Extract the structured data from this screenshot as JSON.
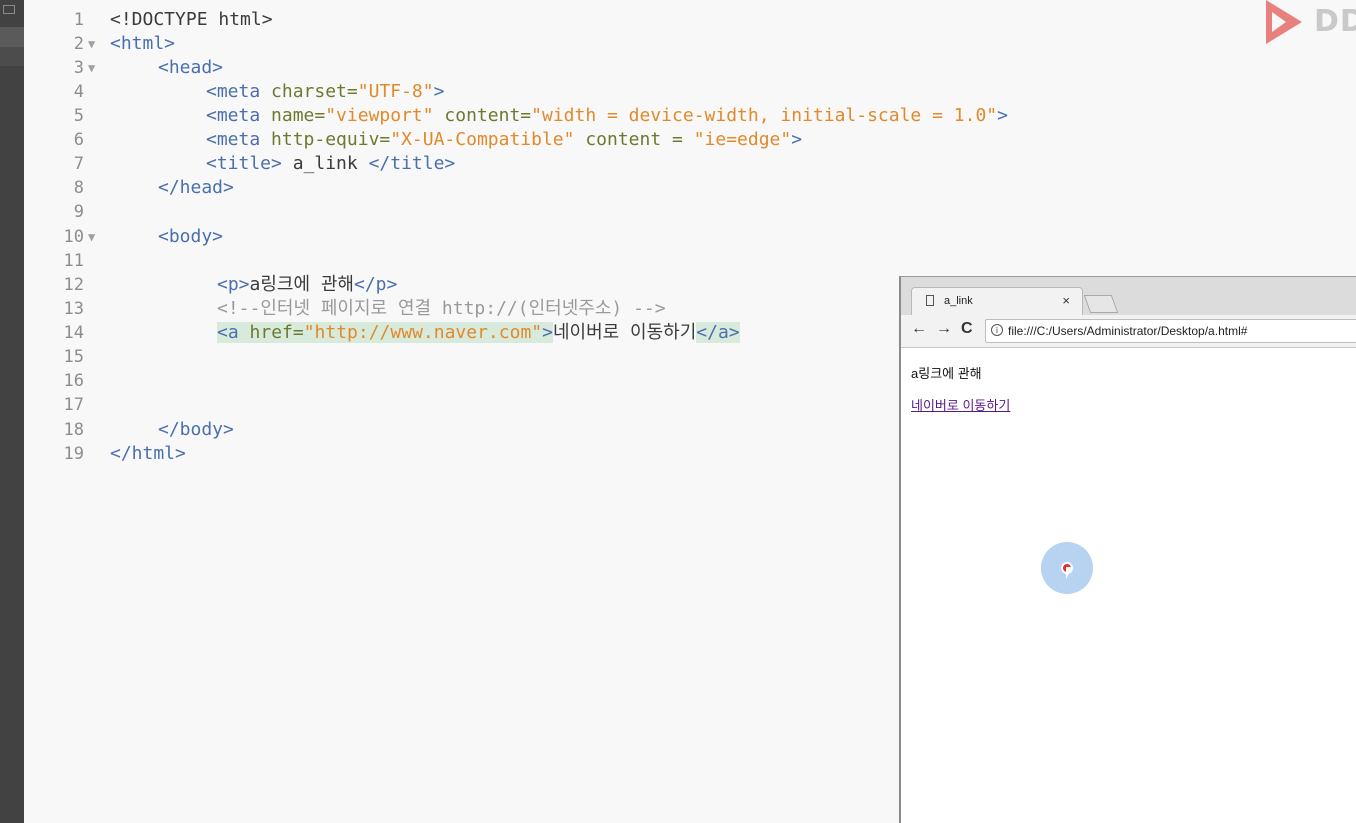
{
  "logo": {
    "text": "DD"
  },
  "editor": {
    "lines": [
      {
        "num": "1",
        "fold": ""
      },
      {
        "num": "2",
        "fold": "▼"
      },
      {
        "num": "3",
        "fold": "▼"
      },
      {
        "num": "4",
        "fold": ""
      },
      {
        "num": "5",
        "fold": ""
      },
      {
        "num": "6",
        "fold": ""
      },
      {
        "num": "7",
        "fold": ""
      },
      {
        "num": "8",
        "fold": ""
      },
      {
        "num": "9",
        "fold": ""
      },
      {
        "num": "10",
        "fold": "▼"
      },
      {
        "num": "11",
        "fold": ""
      },
      {
        "num": "12",
        "fold": ""
      },
      {
        "num": "13",
        "fold": ""
      },
      {
        "num": "14",
        "fold": ""
      },
      {
        "num": "15",
        "fold": ""
      },
      {
        "num": "16",
        "fold": ""
      },
      {
        "num": "17",
        "fold": ""
      },
      {
        "num": "18",
        "fold": ""
      },
      {
        "num": "19",
        "fold": ""
      }
    ],
    "code": {
      "l1": "<!DOCTYPE html>",
      "l2_tag": "<html>",
      "l3_tag": "<head>",
      "l4_open": "<meta ",
      "l4_attr": "charset=",
      "l4_val": "\"UTF-8\"",
      "l4_close": ">",
      "l5_open": "<meta ",
      "l5_attr1": "name=",
      "l5_val1": "\"viewport\"",
      "l5_attr2": " content=",
      "l5_val2": "\"width = device-width, initial-scale = 1.0\"",
      "l5_close": ">",
      "l6_open": "<meta ",
      "l6_attr1": "http-equiv=",
      "l6_val1": "\"X-UA-Compatible\"",
      "l6_attr2": " content = ",
      "l6_val2": "\"ie=edge\"",
      "l6_close": ">",
      "l7_open": "<title>",
      "l7_text": " a_link ",
      "l7_close": "</title>",
      "l8_tag": "</head>",
      "l10_tag": "<body>",
      "l12_open": "<p>",
      "l12_text": "a링크에 관해",
      "l12_close": "</p>",
      "l13_comment": "<!--인터넷 페이지로 연결 http://(인터넷주소) -->",
      "l14_open": "<a ",
      "l14_attr": "href=",
      "l14_val": "\"http://www.naver.com\"",
      "l14_gt": ">",
      "l14_text": "네이버로 이동하기",
      "l14_close": "</a>",
      "l18_tag": "</body>",
      "l19_tag": "</html>"
    }
  },
  "browser": {
    "tab_title": "a_link",
    "tab_close": "×",
    "back": "←",
    "forward": "→",
    "reload": "C",
    "info": "i",
    "url": "file:///C:/Users/Administrator/Desktop/a.html#",
    "page_paragraph": "a링크에 관해",
    "page_link": "네이버로 이동하기"
  }
}
